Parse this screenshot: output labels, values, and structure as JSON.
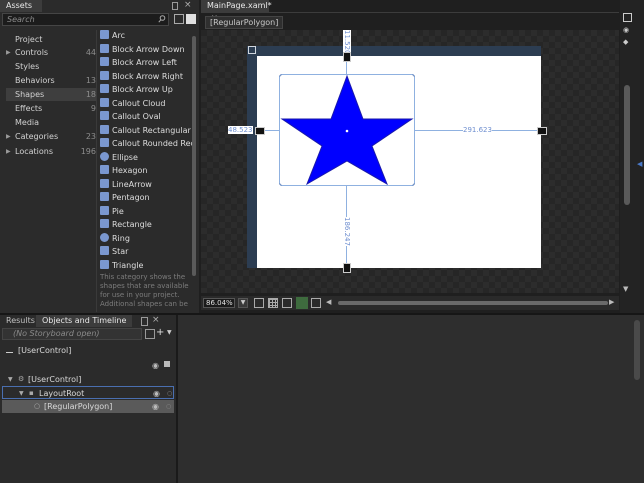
{
  "assets_panel": {
    "tab_label": "Assets",
    "search_placeholder": "Search",
    "categories": [
      {
        "label": "Project",
        "count": ""
      },
      {
        "label": "Controls",
        "count": "44"
      },
      {
        "label": "Styles",
        "count": ""
      },
      {
        "label": "Behaviors",
        "count": "13"
      },
      {
        "label": "Shapes",
        "count": "18"
      },
      {
        "label": "Effects",
        "count": "9"
      },
      {
        "label": "Media",
        "count": ""
      },
      {
        "label": "Categories",
        "count": "23"
      },
      {
        "label": "Locations",
        "count": "196"
      }
    ],
    "shapes": [
      {
        "label": "Arc",
        "icon": "arc-icon"
      },
      {
        "label": "Block Arrow Down",
        "icon": "block-arrow-down-icon"
      },
      {
        "label": "Block Arrow Left",
        "icon": "block-arrow-left-icon"
      },
      {
        "label": "Block Arrow Right",
        "icon": "block-arrow-right-icon"
      },
      {
        "label": "Block Arrow Up",
        "icon": "block-arrow-up-icon"
      },
      {
        "label": "Callout Cloud",
        "icon": "callout-cloud-icon"
      },
      {
        "label": "Callout Oval",
        "icon": "callout-oval-icon"
      },
      {
        "label": "Callout Rectangular",
        "icon": "callout-rectangular-icon"
      },
      {
        "label": "Callout Rounded Rect...",
        "icon": "callout-rounded-icon"
      },
      {
        "label": "Ellipse",
        "icon": "ellipse-icon"
      },
      {
        "label": "Hexagon",
        "icon": "hexagon-icon"
      },
      {
        "label": "LineArrow",
        "icon": "line-arrow-icon"
      },
      {
        "label": "Pentagon",
        "icon": "pentagon-icon"
      },
      {
        "label": "Pie",
        "icon": "pie-icon"
      },
      {
        "label": "Rectangle",
        "icon": "rectangle-icon"
      },
      {
        "label": "Ring",
        "icon": "ring-icon"
      },
      {
        "label": "Star",
        "icon": "star-icon"
      },
      {
        "label": "Triangle",
        "icon": "triangle-icon"
      }
    ],
    "hint_text": "This category shows the shapes that are available for use in your project. Additional shapes can be"
  },
  "document": {
    "tab_label": "MainPage.xaml*",
    "breadcrumb": "[RegularPolygon]",
    "zoom": "86.04%",
    "dims": {
      "top": "11.520",
      "left": "48.523",
      "right": "291.623",
      "bottom": "186.247"
    },
    "star_color": "#0000ff"
  },
  "objects_panel": {
    "tab_results": "Results",
    "tab_objects": "Objects and Timeline",
    "storyboard": "(No Storyboard open)",
    "user_control_root": "[UserControl]",
    "tree": [
      {
        "label": "[UserControl]"
      },
      {
        "label": "LayoutRoot"
      },
      {
        "label": "[RegularPolygon]"
      }
    ]
  }
}
